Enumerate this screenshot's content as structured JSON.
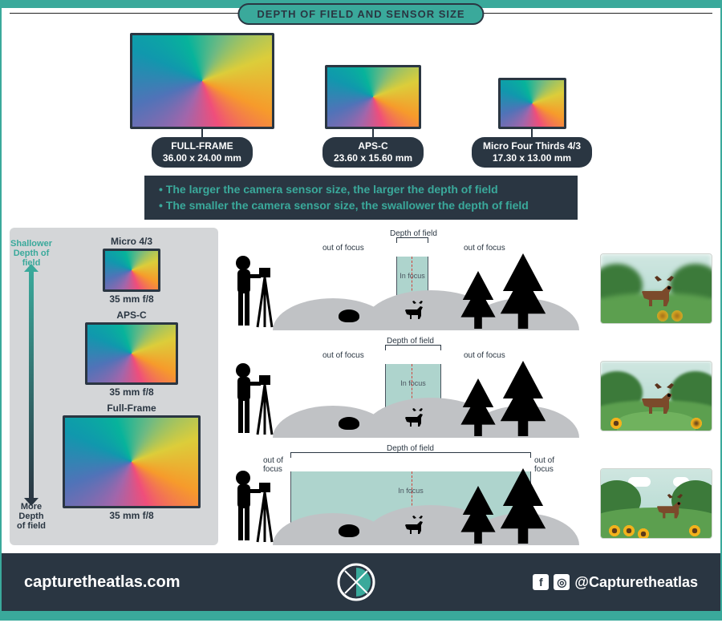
{
  "title": "DEPTH OF FIELD AND SENSOR SIZE",
  "sensors_top": [
    {
      "name": "FULL-FRAME",
      "dims": "36.00 x 24.00 mm"
    },
    {
      "name": "APS-C",
      "dims": "23.60 x 15.60 mm"
    },
    {
      "name": "Micro Four Thirds 4/3",
      "dims": "17.30 x 13.00 mm"
    }
  ],
  "bullets": [
    "The larger the camera sensor size, the larger the depth of field",
    "The smaller the camera sensor size, the swallower the depth of field"
  ],
  "left": {
    "shallow": "Shallower Depth of field",
    "more": "More Depth of field",
    "rows": [
      {
        "name": "Micro 4/3",
        "spec": "35 mm f/8"
      },
      {
        "name": "APS-C",
        "spec": "35 mm f/8"
      },
      {
        "name": "Full-Frame",
        "spec": "35 mm f/8"
      }
    ]
  },
  "scene": {
    "depth_of_field": "Depth of field",
    "in_focus": "In focus",
    "out_of_focus": "out of focus",
    "out_of_focus_split": "out of\nfocus"
  },
  "footer": {
    "url": "capturetheatlas.com",
    "handle": "@Capturetheatlas"
  }
}
